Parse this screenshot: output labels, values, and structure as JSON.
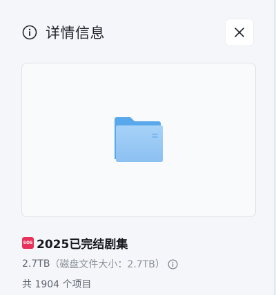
{
  "header": {
    "title": "详情信息"
  },
  "file": {
    "badge": "SOS",
    "name": "2025已完结剧集",
    "size": "2.7TB",
    "size_detail": "（磁盘文件大小：2.7TB）",
    "item_count": "共 1904 个项目"
  },
  "icons": {
    "header_info": "info-circle-icon",
    "close": "close-icon",
    "preview": "folder-icon",
    "size_info": "info-circle-icon"
  },
  "colors": {
    "badge": "#e8325b",
    "folder_front": "#9ccbf5",
    "folder_back": "#5aa8ec"
  }
}
